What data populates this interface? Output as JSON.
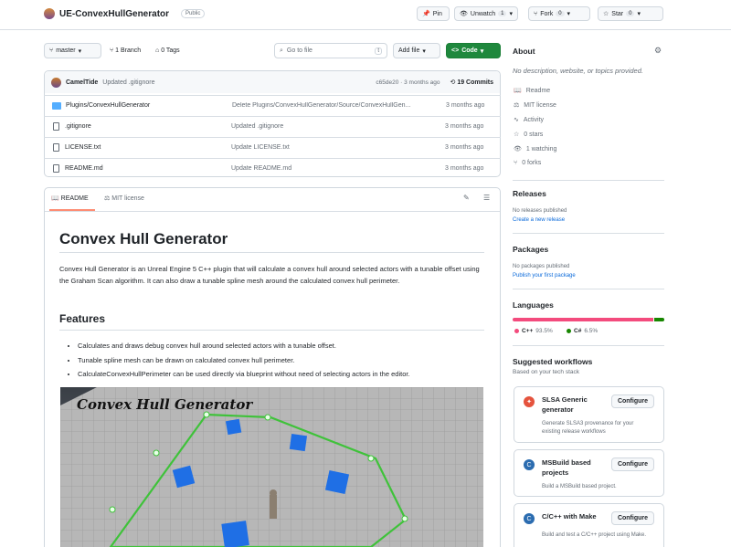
{
  "repo": {
    "name": "UE-ConvexHullGenerator",
    "visibility": "Public"
  },
  "actions": {
    "pin": "Pin",
    "unwatch": "Unwatch",
    "unwatch_count": "1",
    "fork": "Fork",
    "fork_count": "0",
    "star": "Star",
    "star_count": "0"
  },
  "toolbar": {
    "branch": "master",
    "branches": "1 Branch",
    "tags": "0 Tags",
    "goto_placeholder": "Go to file",
    "goto_key": "t",
    "add_file": "Add file",
    "code": "Code"
  },
  "commit": {
    "author": "CamelTide",
    "message": "Updated .gitignore",
    "meta": "c65de20 · 3 months ago",
    "commits": "19 Commits"
  },
  "files": [
    {
      "name": "Plugins/ConvexHullGenerator",
      "type": "folder",
      "message": "Delete Plugins/ConvexHullGenerator/Source/ConvexHullGen...",
      "time": "3 months ago"
    },
    {
      "name": ".gitignore",
      "type": "file",
      "message": "Updated .gitignore",
      "time": "3 months ago"
    },
    {
      "name": "LICENSE.txt",
      "type": "file",
      "message": "Update LICENSE.txt",
      "time": "3 months ago"
    },
    {
      "name": "README.md",
      "type": "file",
      "message": "Update README.md",
      "time": "3 months ago"
    }
  ],
  "readme": {
    "tab_readme": "README",
    "tab_license": "MIT license",
    "title": "Convex Hull Generator",
    "intro": "Convex Hull Generator is an Unreal Engine 5 C++ plugin that will calculate a convex hull around selected actors with a tunable offset using the Graham Scan algorithm. It can also draw a tunable spline mesh around the calculated convex hull perimeter.",
    "features_heading": "Features",
    "features": [
      "Calculates and draws debug convex hull around selected actors with a tunable offset.",
      "Tunable spline mesh can be drawn on calculated convex hull perimeter.",
      "CalculateConvexHullPerimeter can be used directly via blueprint without need of selecting actors in the editor."
    ],
    "image_caption": "Convex Hull Generator"
  },
  "about": {
    "heading": "About",
    "description": "No description, website, or topics provided.",
    "items": [
      {
        "icon": "book-icon",
        "label": "Readme"
      },
      {
        "icon": "scale-icon",
        "label": "MIT license"
      },
      {
        "icon": "pulse-icon",
        "label": "Activity"
      },
      {
        "icon": "star-icon",
        "label": "0 stars"
      },
      {
        "icon": "eye-icon",
        "label": "1 watching"
      },
      {
        "icon": "fork-icon",
        "label": "0 forks"
      }
    ]
  },
  "releases": {
    "heading": "Releases",
    "none": "No releases published",
    "link": "Create a new release"
  },
  "packages": {
    "heading": "Packages",
    "none": "No packages published",
    "link": "Publish your first package"
  },
  "languages": {
    "heading": "Languages",
    "items": [
      {
        "name": "C++",
        "percent": "93.5%",
        "value": 93.5,
        "color": "#f34b7d"
      },
      {
        "name": "C#",
        "percent": "6.5%",
        "value": 6.5,
        "color": "#178600"
      }
    ]
  },
  "workflows": {
    "heading": "Suggested workflows",
    "subheading": "Based on your tech stack",
    "configure": "Configure",
    "items": [
      {
        "title": "SLSA Generic generator",
        "desc": "Generate SLSA3 provenance for your existing release workflows",
        "icon_color": "#e5533d"
      },
      {
        "title": "MSBuild based projects",
        "desc": "Build a MSBuild based project.",
        "icon_color": "#2b6cb0"
      },
      {
        "title": "C/C++ with Make",
        "desc": "Build and test a C/C++ project using Make.",
        "icon_color": "#2b6cb0"
      }
    ]
  }
}
